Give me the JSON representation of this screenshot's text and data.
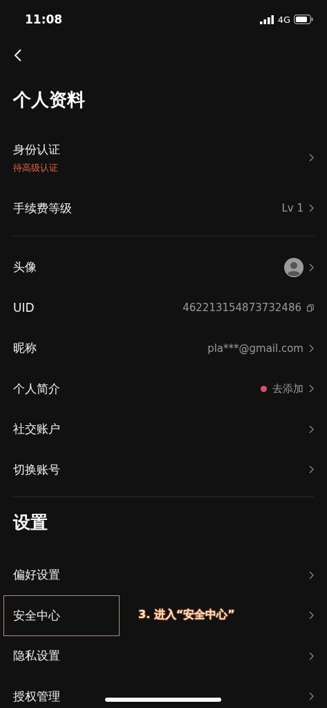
{
  "status_bar": {
    "time": "11:08",
    "network": "4G"
  },
  "header": {
    "title": "个人资料"
  },
  "groups": [
    {
      "rows": [
        {
          "kind": "subtitle",
          "label": "身份认证",
          "subtitle": "待高级认证",
          "highlighted": false
        },
        {
          "kind": "value",
          "label": "手续费等级",
          "value": "Lv 1",
          "highlighted": false
        }
      ]
    },
    {
      "rows": [
        {
          "kind": "avatar",
          "label": "头像",
          "highlighted": false
        },
        {
          "kind": "copy",
          "label": "UID",
          "value": "462213154873732486",
          "highlighted": false
        },
        {
          "kind": "value",
          "label": "昵称",
          "value": "pla***@gmail.com",
          "highlighted": false
        },
        {
          "kind": "dot",
          "label": "个人简介",
          "value": "去添加",
          "color": "#d9506a",
          "highlighted": false
        },
        {
          "kind": "plain",
          "label": "社交账户",
          "highlighted": false
        },
        {
          "kind": "plain",
          "label": "切换账号",
          "highlighted": false
        }
      ]
    },
    {
      "title": "设置",
      "rows": [
        {
          "kind": "plain",
          "label": "偏好设置",
          "highlighted": false
        },
        {
          "kind": "plain",
          "label": "安全中心",
          "highlighted": true,
          "annotation": "3. 进入“安全中心”"
        },
        {
          "kind": "plain",
          "label": "隐私设置",
          "highlighted": false
        },
        {
          "kind": "plain",
          "label": "授权管理",
          "highlighted": false
        }
      ]
    }
  ]
}
